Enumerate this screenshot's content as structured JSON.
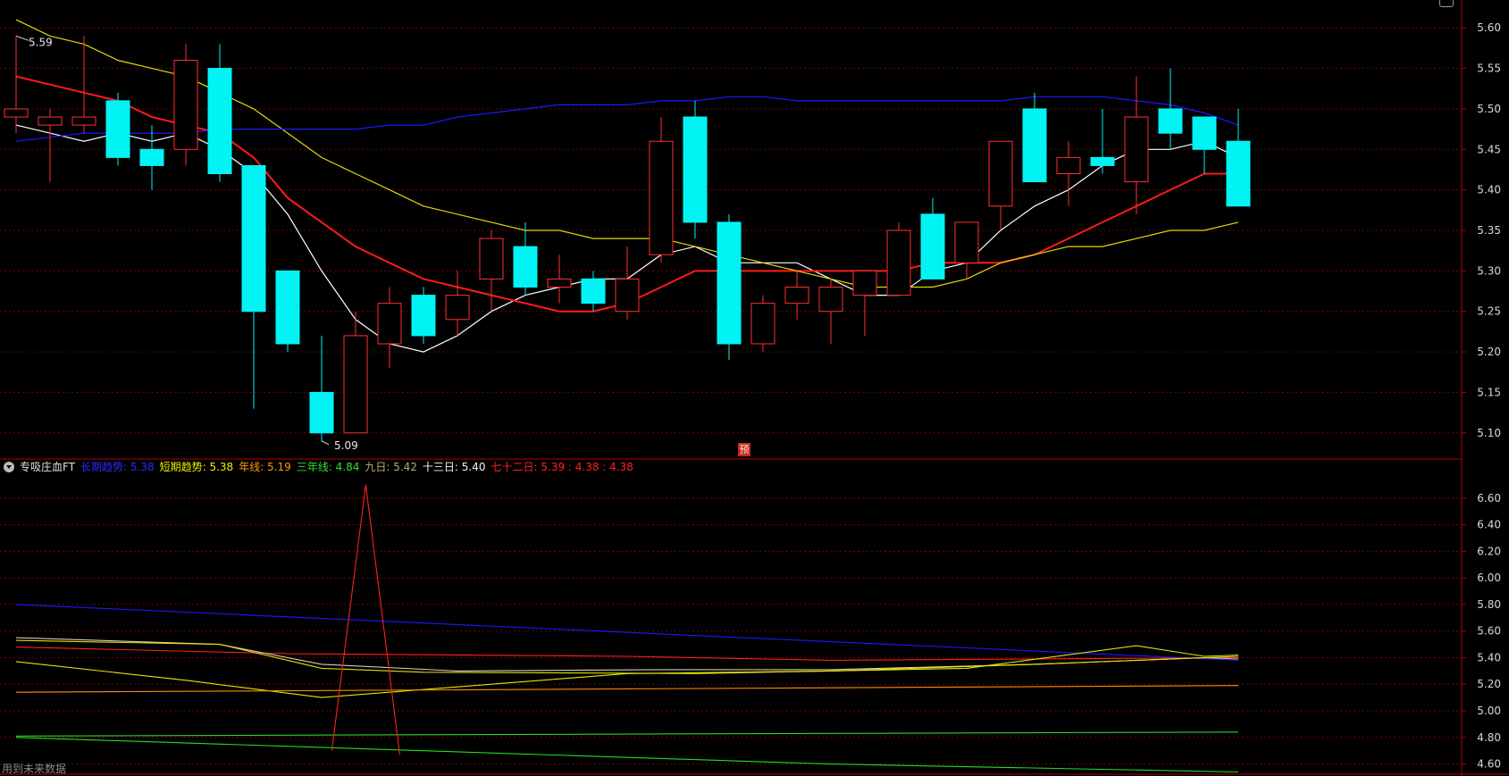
{
  "chart_data": [
    {
      "type": "candlestick",
      "panel": "price",
      "ylim": [
        5.07,
        5.63
      ],
      "yticks": [
        "5.10",
        "5.15",
        "5.20",
        "5.25",
        "5.30",
        "5.35",
        "5.40",
        "5.45",
        "5.50",
        "5.55",
        "5.60"
      ],
      "grid": true,
      "candles": [
        {
          "o": 5.49,
          "h": 5.59,
          "l": 5.47,
          "c": 5.5
        },
        {
          "o": 5.48,
          "h": 5.5,
          "l": 5.41,
          "c": 5.49
        },
        {
          "o": 5.48,
          "h": 5.59,
          "l": 5.47,
          "c": 5.49
        },
        {
          "o": 5.51,
          "h": 5.52,
          "l": 5.43,
          "c": 5.44
        },
        {
          "o": 5.45,
          "h": 5.48,
          "l": 5.4,
          "c": 5.43
        },
        {
          "o": 5.45,
          "h": 5.58,
          "l": 5.43,
          "c": 5.56
        },
        {
          "o": 5.55,
          "h": 5.58,
          "l": 5.41,
          "c": 5.42
        },
        {
          "o": 5.43,
          "h": 5.43,
          "l": 5.13,
          "c": 5.25
        },
        {
          "o": 5.3,
          "h": 5.3,
          "l": 5.2,
          "c": 5.21
        },
        {
          "o": 5.15,
          "h": 5.22,
          "l": 5.09,
          "c": 5.1
        },
        {
          "o": 5.1,
          "h": 5.25,
          "l": 5.1,
          "c": 5.22
        },
        {
          "o": 5.21,
          "h": 5.28,
          "l": 5.18,
          "c": 5.26
        },
        {
          "o": 5.27,
          "h": 5.28,
          "l": 5.21,
          "c": 5.22
        },
        {
          "o": 5.24,
          "h": 5.3,
          "l": 5.22,
          "c": 5.27
        },
        {
          "o": 5.29,
          "h": 5.35,
          "l": 5.25,
          "c": 5.34
        },
        {
          "o": 5.33,
          "h": 5.36,
          "l": 5.27,
          "c": 5.28
        },
        {
          "o": 5.28,
          "h": 5.32,
          "l": 5.26,
          "c": 5.29
        },
        {
          "o": 5.29,
          "h": 5.3,
          "l": 5.25,
          "c": 5.26
        },
        {
          "o": 5.25,
          "h": 5.33,
          "l": 5.24,
          "c": 5.29
        },
        {
          "o": 5.32,
          "h": 5.49,
          "l": 5.31,
          "c": 5.46
        },
        {
          "o": 5.49,
          "h": 5.51,
          "l": 5.34,
          "c": 5.36
        },
        {
          "o": 5.36,
          "h": 5.37,
          "l": 5.19,
          "c": 5.21
        },
        {
          "o": 5.21,
          "h": 5.27,
          "l": 5.2,
          "c": 5.26
        },
        {
          "o": 5.26,
          "h": 5.3,
          "l": 5.24,
          "c": 5.28
        },
        {
          "o": 5.25,
          "h": 5.29,
          "l": 5.21,
          "c": 5.28
        },
        {
          "o": 5.27,
          "h": 5.29,
          "l": 5.22,
          "c": 5.3
        },
        {
          "o": 5.27,
          "h": 5.36,
          "l": 5.27,
          "c": 5.35
        },
        {
          "o": 5.37,
          "h": 5.39,
          "l": 5.29,
          "c": 5.29
        },
        {
          "o": 5.31,
          "h": 5.36,
          "l": 5.29,
          "c": 5.36
        },
        {
          "o": 5.38,
          "h": 5.46,
          "l": 5.35,
          "c": 5.46
        },
        {
          "o": 5.5,
          "h": 5.52,
          "l": 5.41,
          "c": 5.41
        },
        {
          "o": 5.42,
          "h": 5.46,
          "l": 5.38,
          "c": 5.44
        },
        {
          "o": 5.44,
          "h": 5.5,
          "l": 5.42,
          "c": 5.43
        },
        {
          "o": 5.41,
          "h": 5.54,
          "l": 5.37,
          "c": 5.49
        },
        {
          "o": 5.5,
          "h": 5.55,
          "l": 5.45,
          "c": 5.47
        },
        {
          "o": 5.49,
          "h": 5.49,
          "l": 5.42,
          "c": 5.45
        },
        {
          "o": 5.46,
          "h": 5.5,
          "l": 5.38,
          "c": 5.38
        }
      ],
      "series": [
        {
          "color": "#ffffff",
          "values": [
            5.48,
            5.47,
            5.46,
            5.47,
            5.46,
            5.47,
            5.45,
            5.42,
            5.37,
            5.3,
            5.24,
            5.21,
            5.2,
            5.22,
            5.25,
            5.27,
            5.28,
            5.29,
            5.29,
            5.32,
            5.33,
            5.31,
            5.31,
            5.31,
            5.29,
            5.27,
            5.27,
            5.3,
            5.31,
            5.35,
            5.38,
            5.4,
            5.43,
            5.45,
            5.45,
            5.46,
            5.44
          ]
        },
        {
          "color": "#ff1a1a",
          "values": [
            5.54,
            5.53,
            5.52,
            5.51,
            5.49,
            5.48,
            5.47,
            5.44,
            5.39,
            5.36,
            5.33,
            5.31,
            5.29,
            5.28,
            5.27,
            5.26,
            5.25,
            5.25,
            5.26,
            5.28,
            5.3,
            5.3,
            5.3,
            5.3,
            5.3,
            5.3,
            5.3,
            5.31,
            5.31,
            5.31,
            5.32,
            5.34,
            5.36,
            5.38,
            5.4,
            5.42,
            5.42
          ]
        },
        {
          "color": "#e8d800",
          "values": [
            5.61,
            5.59,
            5.58,
            5.56,
            5.55,
            5.54,
            5.52,
            5.5,
            5.47,
            5.44,
            5.42,
            5.4,
            5.38,
            5.37,
            5.36,
            5.35,
            5.35,
            5.34,
            5.34,
            5.34,
            5.33,
            5.32,
            5.31,
            5.3,
            5.29,
            5.28,
            5.28,
            5.28,
            5.29,
            5.31,
            5.32,
            5.33,
            5.33,
            5.34,
            5.35,
            5.35,
            5.36
          ]
        },
        {
          "color": "#1a1aff",
          "values": [
            5.46,
            5.465,
            5.47,
            5.47,
            5.47,
            5.47,
            5.475,
            5.475,
            5.475,
            5.475,
            5.475,
            5.48,
            5.48,
            5.49,
            5.495,
            5.5,
            5.505,
            5.505,
            5.505,
            5.51,
            5.51,
            5.515,
            5.515,
            5.51,
            5.51,
            5.51,
            5.51,
            5.51,
            5.51,
            5.51,
            5.515,
            5.515,
            5.515,
            5.51,
            5.505,
            5.495,
            5.48
          ]
        }
      ],
      "annotations": {
        "high_label": "5.59",
        "low_label": "5.09"
      }
    },
    {
      "type": "line",
      "panel": "indicator",
      "ylim": [
        4.53,
        6.78
      ],
      "yticks": [
        "4.60",
        "4.80",
        "5.00",
        "5.20",
        "5.40",
        "5.60",
        "5.80",
        "6.00",
        "6.20",
        "6.40",
        "6.60"
      ],
      "grid": true,
      "x_count": 37,
      "series": [
        {
          "color": "#1a1aff",
          "points": [
            [
              0,
              5.8
            ],
            [
              36,
              5.38
            ]
          ]
        },
        {
          "color": "#ff2020",
          "points": [
            [
              0,
              5.48
            ],
            [
              8,
              5.43
            ],
            [
              18,
              5.41
            ],
            [
              24,
              5.38
            ],
            [
              36,
              5.4
            ]
          ]
        },
        {
          "color": "#d8d0b0",
          "points": [
            [
              0,
              5.55
            ],
            [
              6,
              5.5
            ],
            [
              9,
              5.35
            ],
            [
              13,
              5.3
            ],
            [
              19,
              5.31
            ],
            [
              24,
              5.31
            ],
            [
              30,
              5.35
            ],
            [
              35,
              5.4
            ],
            [
              36,
              5.39
            ]
          ]
        },
        {
          "color": "#e0e010",
          "points": [
            [
              0,
              5.53
            ],
            [
              6,
              5.5
            ],
            [
              9,
              5.32
            ],
            [
              12,
              5.29
            ],
            [
              20,
              5.28
            ],
            [
              28,
              5.32
            ],
            [
              33,
              5.49
            ],
            [
              35,
              5.41
            ],
            [
              36,
              5.42
            ]
          ]
        },
        {
          "color": "#e8e800",
          "points": [
            [
              0,
              5.37
            ],
            [
              5,
              5.23
            ],
            [
              9,
              5.1
            ],
            [
              13,
              5.18
            ],
            [
              18,
              5.28
            ],
            [
              24,
              5.3
            ],
            [
              30,
              5.35
            ],
            [
              36,
              5.41
            ]
          ]
        },
        {
          "color": "#ff8c00",
          "points": [
            [
              0,
              5.14
            ],
            [
              36,
              5.19
            ]
          ]
        },
        {
          "color": "#30d030",
          "points": [
            [
              0,
              4.81
            ],
            [
              36,
              4.84
            ]
          ]
        },
        {
          "color": "#20e020",
          "points": [
            [
              0,
              4.8
            ],
            [
              12,
              4.7
            ],
            [
              24,
              4.6
            ],
            [
              36,
              4.54
            ]
          ]
        },
        {
          "color": "#ff2020",
          "points": [
            [
              9.3,
              4.7
            ],
            [
              10.3,
              6.7
            ],
            [
              11.3,
              4.67
            ]
          ],
          "stepped": false
        }
      ]
    }
  ],
  "indicator_legend": {
    "name": "专吸庄血FT",
    "items": [
      {
        "label": "长期趋势: 5.38",
        "color": "#2a2aff"
      },
      {
        "label": "短期趋势: 5.38",
        "color": "#f0f000"
      },
      {
        "label": "年线: 5.19",
        "color": "#ff9a00"
      },
      {
        "label": "三年线: 4.84",
        "color": "#30e030"
      },
      {
        "label": "九日: 5.42",
        "color": "#b8b070"
      },
      {
        "label": "十三日: 5.40",
        "color": "#f2f2f2"
      },
      {
        "label": "七十二日: 5.39 : 4.38 : 4.38",
        "color": "#ff2020"
      }
    ],
    "extra": {
      "label": ": 4.38",
      "color": "#40ff40"
    }
  },
  "forecast_tag": "预",
  "footer_note": "用到未来数据",
  "colors": {
    "up": "#ff3030",
    "down": "#00f4f4",
    "grid": "#7a0000",
    "axis_text": "#d9d9d9",
    "border": "#b00000"
  }
}
